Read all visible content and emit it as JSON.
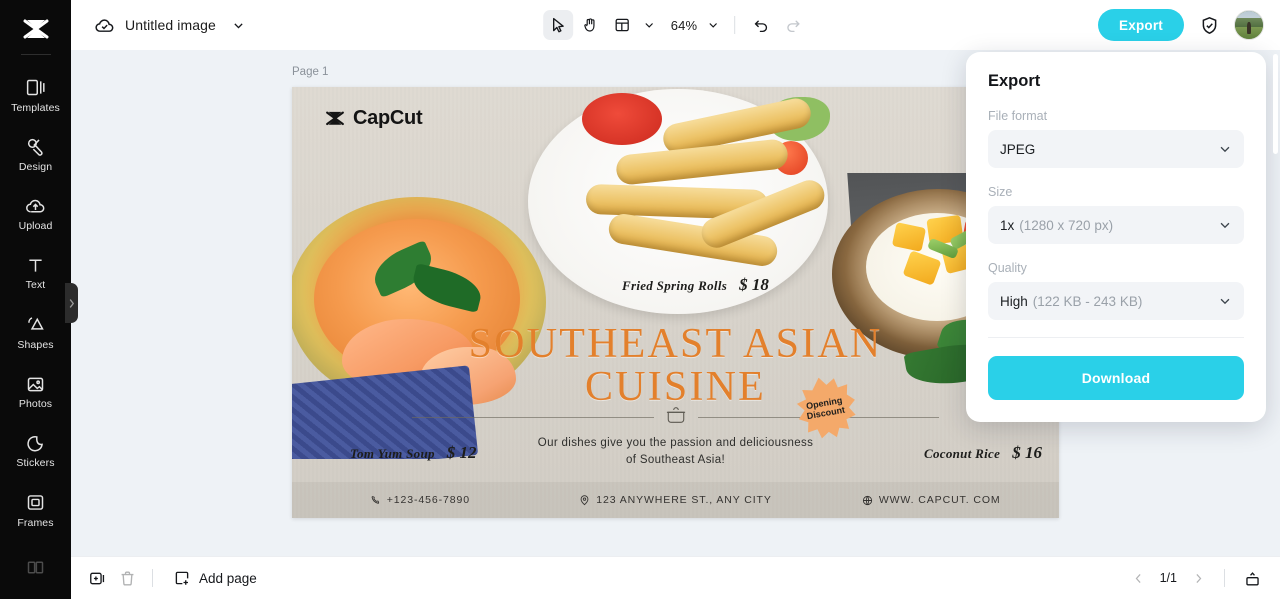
{
  "sidebar": {
    "logo": "capcut-logo",
    "items": [
      {
        "label": "Templates",
        "icon": "templates-icon"
      },
      {
        "label": "Design",
        "icon": "design-icon"
      },
      {
        "label": "Upload",
        "icon": "upload-icon"
      },
      {
        "label": "Text",
        "icon": "text-icon"
      },
      {
        "label": "Shapes",
        "icon": "shapes-icon"
      },
      {
        "label": "Photos",
        "icon": "photos-icon"
      },
      {
        "label": "Stickers",
        "icon": "stickers-icon"
      },
      {
        "label": "Frames",
        "icon": "frames-icon"
      },
      {
        "label": "",
        "icon": "layouts-icon"
      }
    ]
  },
  "topbar": {
    "cloud_icon": "cloud-check-icon",
    "doc_title": "Untitled image",
    "title_chevron": "chevron-down-icon",
    "tools": [
      {
        "name": "select-tool",
        "icon": "cursor-arrow-icon",
        "active": true
      },
      {
        "name": "hand-tool",
        "icon": "hand-icon",
        "active": false
      },
      {
        "name": "layout-tool",
        "icon": "layout-grid-icon",
        "active": false
      }
    ],
    "zoom_value": "64%",
    "undo_icon": "undo-icon",
    "redo_icon": "redo-icon",
    "export_label": "Export",
    "shield_icon": "shield-check-icon",
    "avatar": "user-avatar"
  },
  "workarea": {
    "page_label": "Page 1"
  },
  "design": {
    "brand": "CapCut",
    "headline_line1": "SOUTHEAST ASIAN",
    "headline_line2": "CUISINE",
    "tagline_line1": "Our dishes give you the passion and deliciousness",
    "tagline_line2": "of Southeast Asia!",
    "badge_line1": "Opening",
    "badge_line2": "Discount",
    "menu_items": [
      {
        "name": "Fried Spring Rolls",
        "price": "$ 18"
      },
      {
        "name": "Tom Yum Soup",
        "price": "$ 12"
      },
      {
        "name": "Coconut Rice",
        "price": "$ 16"
      }
    ],
    "footer": [
      {
        "icon": "phone-icon",
        "text": "+123-456-7890"
      },
      {
        "icon": "location-icon",
        "text": "123 ANYWHERE ST., ANY CITY"
      },
      {
        "icon": "globe-icon",
        "text": "WWW. CAPCUT. COM"
      }
    ],
    "accent_color": "#e3802c",
    "badge_color": "#f4a96a"
  },
  "export_panel": {
    "title": "Export",
    "file_format_label": "File format",
    "file_format_value": "JPEG",
    "size_label": "Size",
    "size_value": "1x",
    "size_detail": "(1280 x 720 px)",
    "quality_label": "Quality",
    "quality_value": "High",
    "quality_detail": "(122 KB - 243 KB)",
    "download_label": "Download",
    "accent_color": "#2ad0e8"
  },
  "bottombar": {
    "duplicate_icon": "duplicate-page-icon",
    "delete_icon": "trash-icon",
    "add_page_label": "Add page",
    "add_page_icon": "add-page-icon",
    "prev_icon": "chevron-left-icon",
    "page_count": "1/1",
    "next_icon": "chevron-right-icon",
    "panel_icon": "expand-panel-icon"
  }
}
